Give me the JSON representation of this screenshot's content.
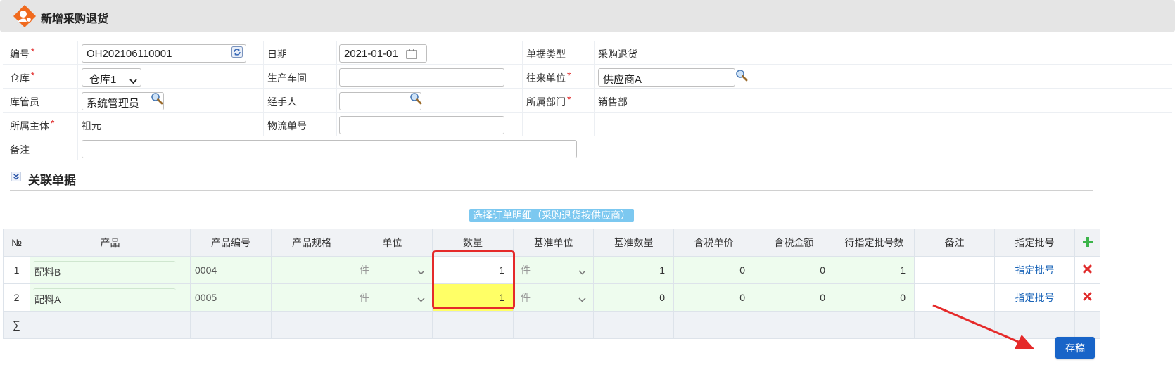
{
  "page_title": "新增采购退货",
  "colors": {
    "accent": "#1864c8",
    "required": "#e12b2b",
    "highlight_cell": "#ffff66",
    "selector_button": "#7cc8f0"
  },
  "form": {
    "code_label": "编号",
    "code_value": "OH202106110001",
    "date_label": "日期",
    "date_value": "2021-01-01",
    "doc_type_label": "单据类型",
    "doc_type_value": "采购退货",
    "warehouse_label": "仓库",
    "warehouse_value": "仓库1",
    "workshop_label": "生产车间",
    "workshop_value": "",
    "partner_label": "往来单位",
    "partner_value": "供应商A",
    "keeper_label": "库管员",
    "keeper_value": "系统管理员",
    "handler_label": "经手人",
    "handler_value": "",
    "dept_label": "所属部门",
    "dept_value": "销售部",
    "entity_label": "所属主体",
    "entity_value": "祖元",
    "tracking_label": "物流单号",
    "tracking_value": "",
    "remark_label": "备注",
    "remark_value": ""
  },
  "section": {
    "title": "关联单据",
    "select_button": "选择订单明细（采购退货按供应商）"
  },
  "table": {
    "headers": [
      "№",
      "产品",
      "产品编号",
      "产品规格",
      "单位",
      "数量",
      "基准单位",
      "基准数量",
      "含税单价",
      "含税金额",
      "待指定批号数",
      "备注",
      "指定批号"
    ],
    "rows": [
      {
        "no": "1",
        "product": "配料B",
        "code": "0004",
        "spec": "",
        "unit": "件",
        "qty": "1",
        "base_unit": "件",
        "base_qty": "1",
        "price": "0",
        "amount": "0",
        "pending": "1",
        "remark": "",
        "batch": "指定批号"
      },
      {
        "no": "2",
        "product": "配料A",
        "code": "0005",
        "spec": "",
        "unit": "件",
        "qty": "1",
        "base_unit": "件",
        "base_qty": "0",
        "price": "0",
        "amount": "0",
        "pending": "0",
        "remark": "",
        "batch": "指定批号"
      }
    ],
    "sum_symbol": "∑"
  },
  "save_button": "存稿"
}
